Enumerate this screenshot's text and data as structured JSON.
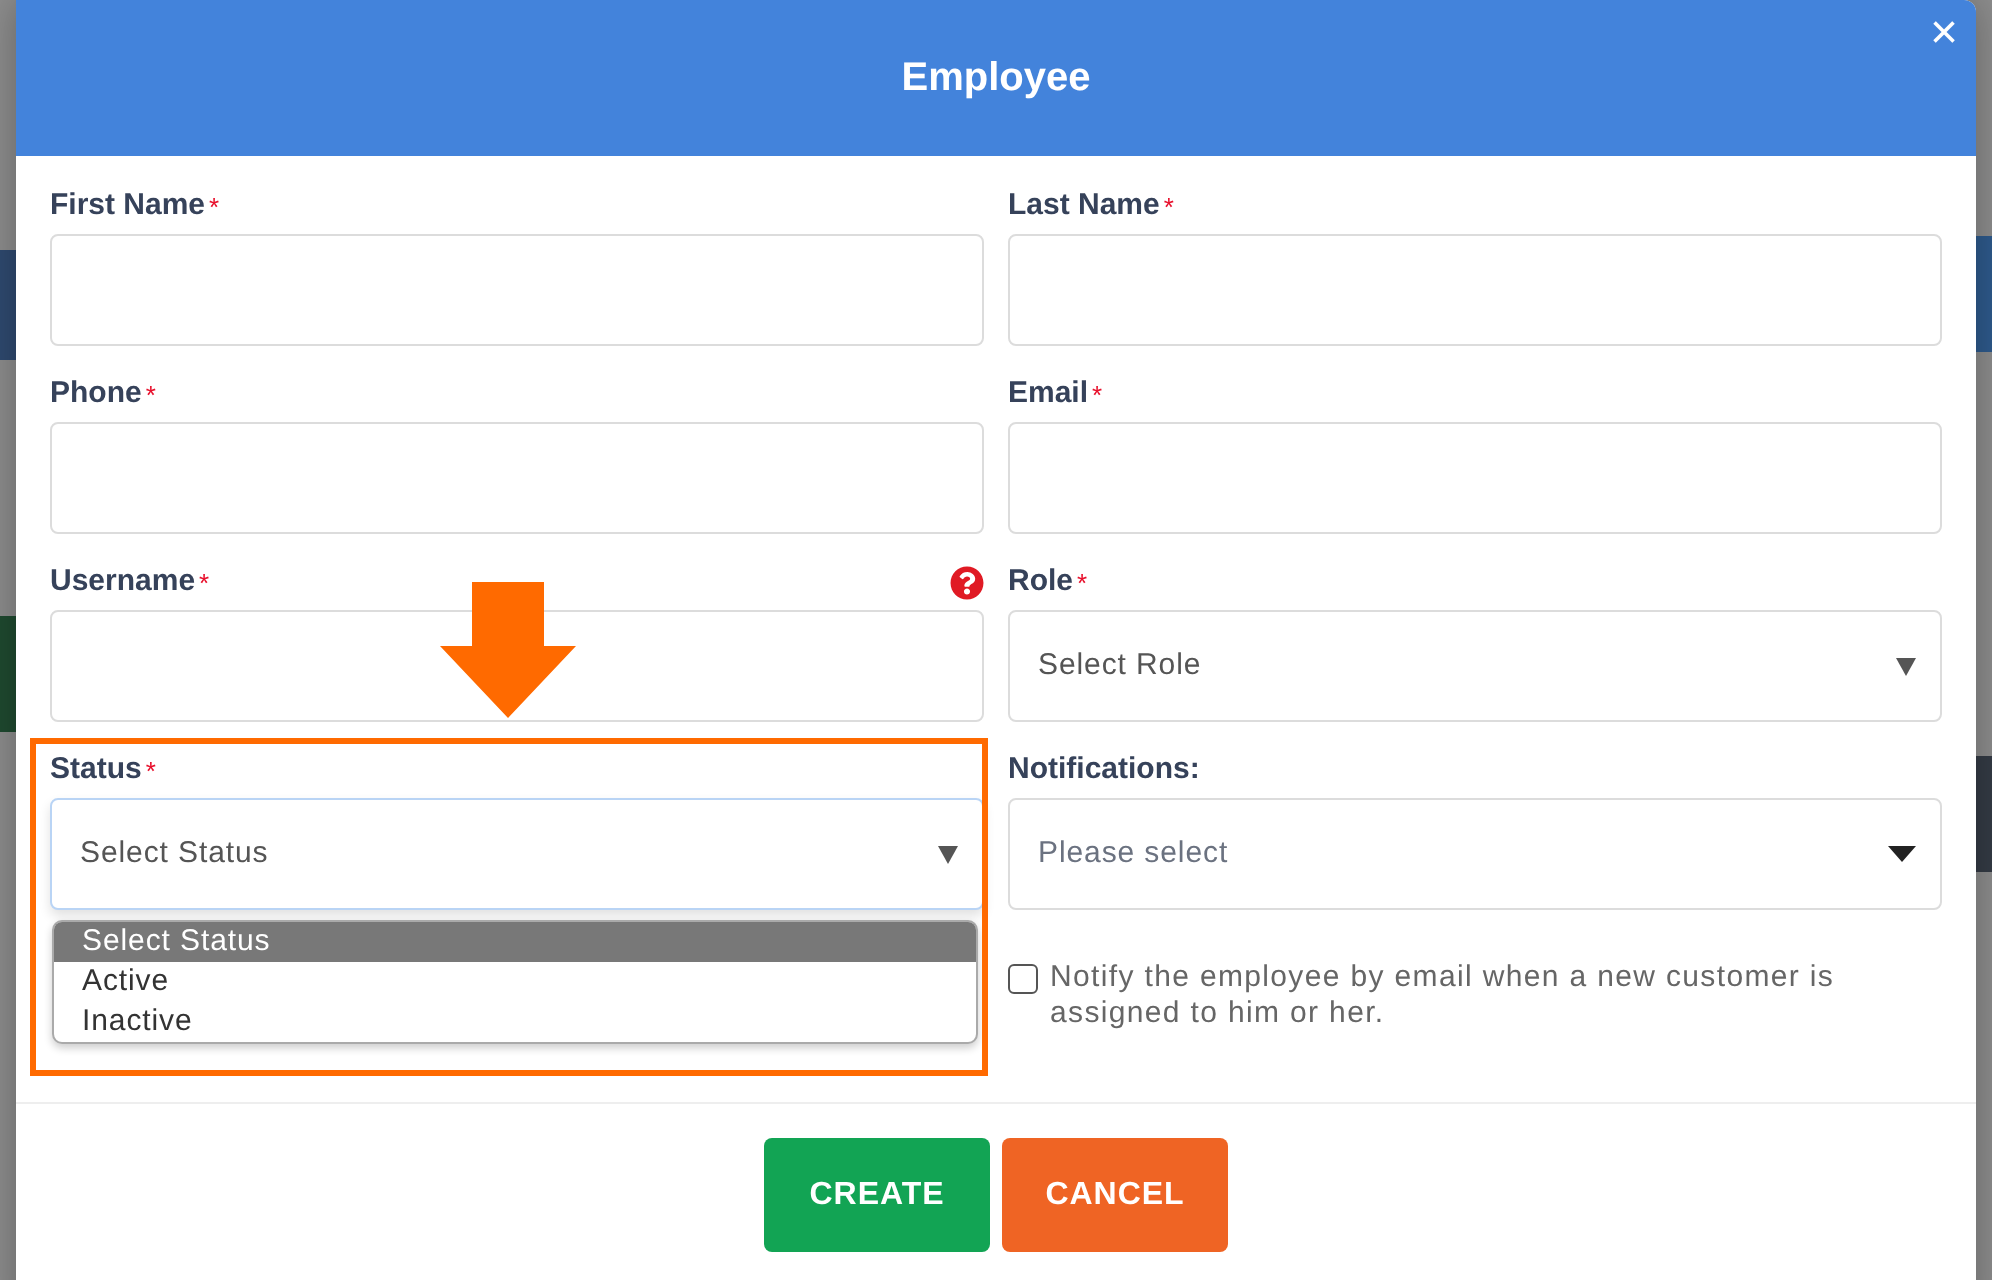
{
  "dialog": {
    "title": "Employee",
    "close": "×"
  },
  "columns": [
    {
      "fields": [
        {
          "kind": "text",
          "label": "First Name",
          "mark": "*",
          "help": false,
          "highlighted": false
        },
        {
          "kind": "text",
          "label": "Phone",
          "mark": "*",
          "help": false,
          "highlighted": false
        },
        {
          "kind": "text",
          "label": "Username",
          "mark": "*",
          "help": true,
          "highlighted": false
        },
        {
          "kind": "select",
          "label": "Status",
          "mark": "*",
          "help": false,
          "highlighted": true,
          "placeholder": "Select Status",
          "focused": true,
          "options": [
            {
              "label": "Select Status",
              "selected": true
            },
            {
              "label": "Active",
              "selected": false
            },
            {
              "label": "Inactive",
              "selected": false
            }
          ]
        }
      ]
    },
    {
      "fields": [
        {
          "kind": "text",
          "label": "Last Name",
          "mark": "*",
          "help": false,
          "highlighted": false
        },
        {
          "kind": "text",
          "label": "Email",
          "mark": "*",
          "help": false,
          "highlighted": false
        },
        {
          "kind": "select",
          "label": "Role",
          "mark": "*",
          "help": false,
          "highlighted": false,
          "placeholder": "Select Role",
          "focused": false
        },
        {
          "kind": "multiselect",
          "label": "Notifications:",
          "help": false,
          "highlighted": false,
          "placeholder": "Please select"
        },
        {
          "kind": "checkbox",
          "label": "Notify the employee by email when a new customer is assigned to him or her.",
          "checked": false
        }
      ]
    }
  ],
  "buttons": [
    {
      "label": "CREATE",
      "kind": "primary"
    },
    {
      "label": "CANCEL",
      "kind": "danger"
    }
  ]
}
